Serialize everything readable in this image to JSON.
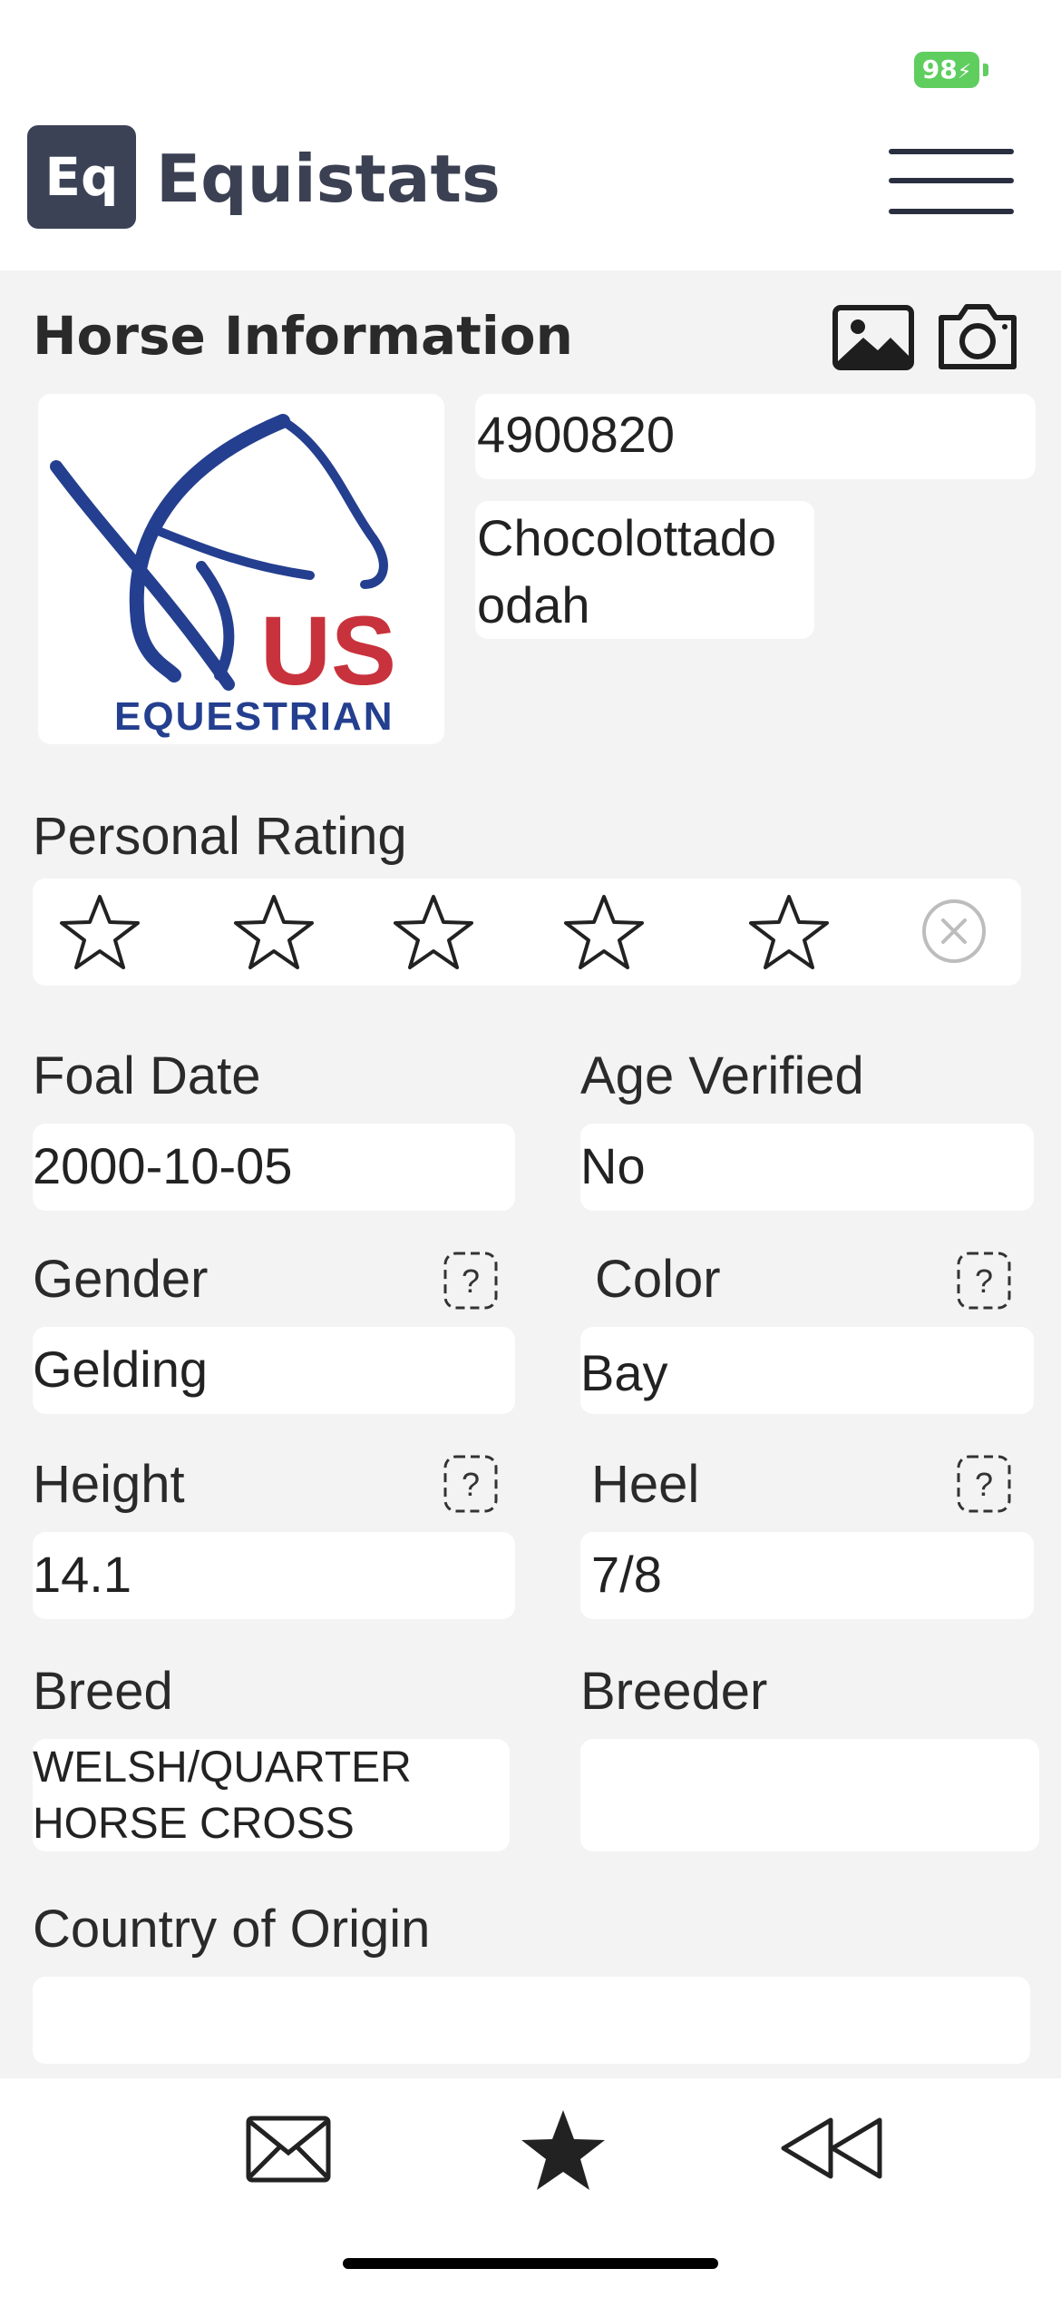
{
  "status": {
    "battery": "98"
  },
  "header": {
    "logo_text": "Eq",
    "app_name": "Equistats"
  },
  "section": {
    "title": "Horse Information"
  },
  "horse": {
    "id": "4900820",
    "name": "Chocolottado odah",
    "image_alt": "US EQUESTRIAN",
    "logo_us": "US",
    "logo_equestrian": "EQUESTRIAN"
  },
  "rating": {
    "label": "Personal Rating",
    "value": 0,
    "max": 5
  },
  "fields": {
    "foal_date": {
      "label": "Foal Date",
      "value": "2000-10-05"
    },
    "age_verified": {
      "label": "Age Verified",
      "value": "No"
    },
    "gender": {
      "label": "Gender",
      "value": "Gelding"
    },
    "color": {
      "label": "Color",
      "value": "Bay"
    },
    "height": {
      "label": "Height",
      "value": "14.1"
    },
    "heel": {
      "label": "Heel",
      "value": "7/8"
    },
    "breed": {
      "label": "Breed",
      "value_line1": "WELSH/QUARTER",
      "value_line2": "HORSE CROSS"
    },
    "breeder": {
      "label": "Breeder",
      "value": ""
    },
    "country": {
      "label": "Country of Origin",
      "value": ""
    }
  },
  "bottom_nav": [
    "envelope-icon",
    "star-icon",
    "rewind-icon"
  ],
  "colors": {
    "accent": "#3c4256",
    "battery": "#5fce5f",
    "logo_blue": "#243f8f",
    "logo_red": "#c8323c"
  }
}
